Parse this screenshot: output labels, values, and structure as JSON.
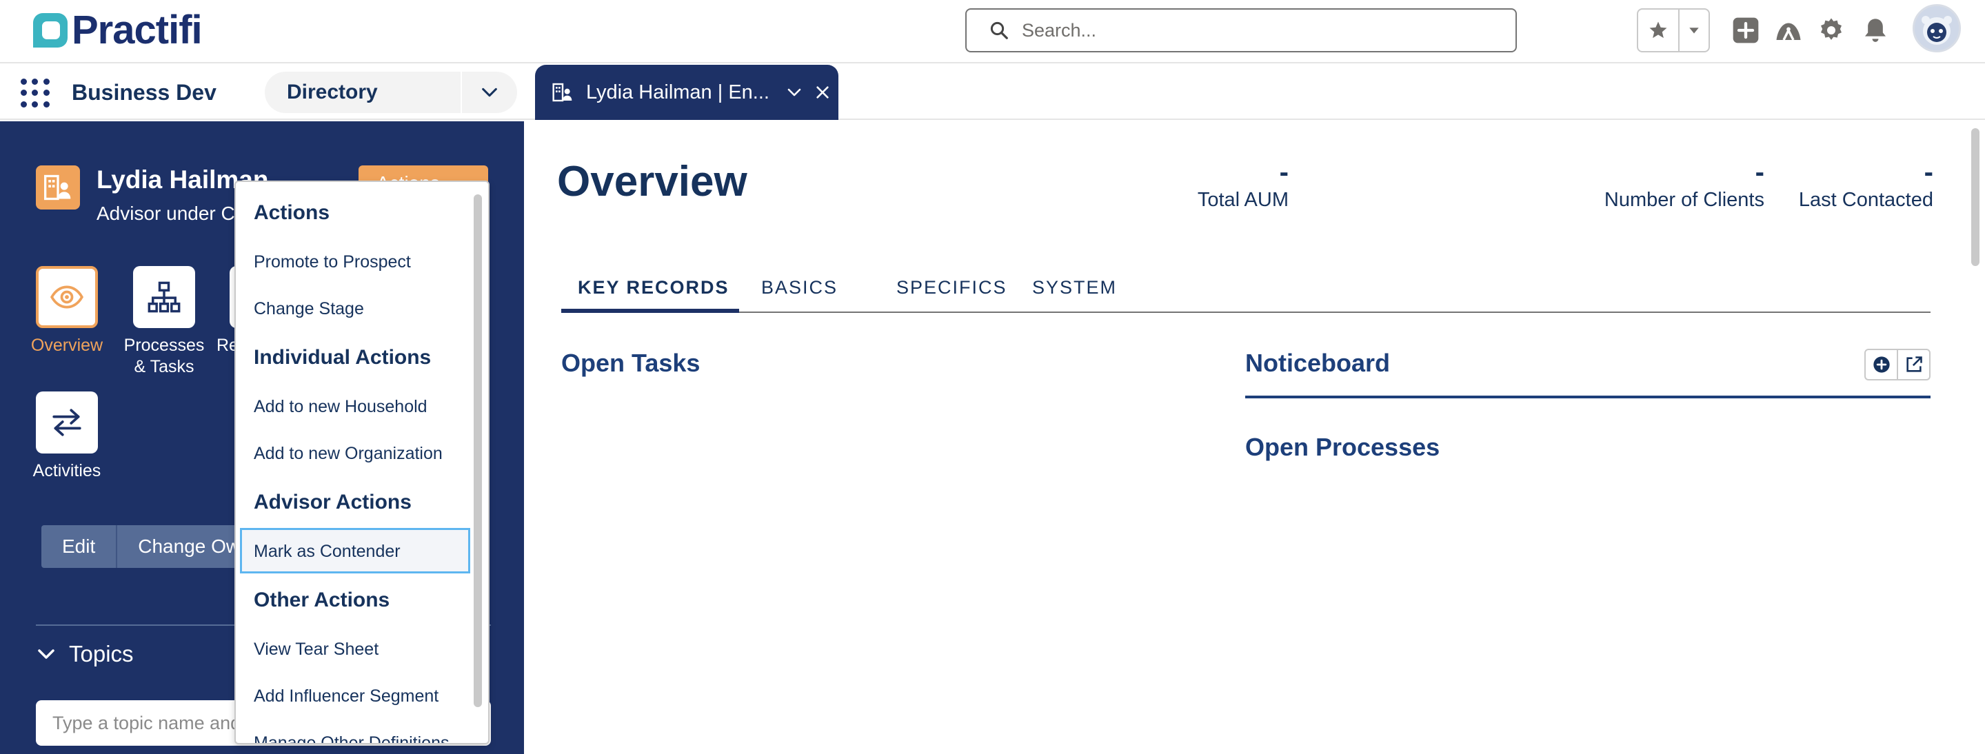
{
  "header": {
    "logo_text": "Practifi",
    "search_placeholder": "Search..."
  },
  "app_nav": {
    "app_name": "Business Dev",
    "nav_item": "Directory",
    "record_tab_label": "Lydia Hailman | En..."
  },
  "record": {
    "name": "Lydia Hailman",
    "subtitle": "Advisor under Co",
    "actions_button": "Actions",
    "nav_tiles": [
      {
        "label": "Overview",
        "icon": "eye-icon",
        "active": true
      },
      {
        "label": "Processes & Tasks",
        "icon": "hierarchy-icon",
        "active": false
      },
      {
        "label": "Re",
        "icon": "relationship-icon",
        "active": false
      },
      {
        "label": "Activities",
        "icon": "arrows-exchange-icon",
        "active": false
      }
    ],
    "edit_label": "Edit",
    "change_owner_label": "Change Ow",
    "topics_label": "Topics",
    "topic_input_placeholder": "Type a topic name and"
  },
  "dropdown": {
    "sections": [
      {
        "heading": "Actions",
        "items": [
          "Promote to Prospect",
          "Change Stage"
        ]
      },
      {
        "heading": "Individual Actions",
        "items": [
          "Add to new Household",
          "Add to new Organization"
        ]
      },
      {
        "heading": "Advisor Actions",
        "items": [
          "Mark as Contender"
        ]
      },
      {
        "heading": "Other Actions",
        "items": [
          "View Tear Sheet",
          "Add Influencer Segment",
          "Manage Other Definitions"
        ]
      }
    ],
    "selected_item": "Mark as Contender"
  },
  "main": {
    "title": "Overview",
    "stats": [
      {
        "value": "-",
        "label": "Total AUM"
      },
      {
        "value": "-",
        "label": "Number of Clients"
      },
      {
        "value": "-",
        "label": "Last Contacted"
      }
    ],
    "tabs": [
      "KEY RECORDS",
      "BASICS",
      "SPECIFICS",
      "SYSTEM"
    ],
    "active_tab": "KEY RECORDS",
    "open_tasks_title": "Open Tasks",
    "noticeboard_title": "Noticeboard",
    "open_processes_title": "Open Processes"
  },
  "colors": {
    "navy": "#1d3166",
    "accent_orange": "#f0a35b",
    "logo_teal": "#3bb4c1",
    "focus_blue": "#5eb6f0"
  }
}
